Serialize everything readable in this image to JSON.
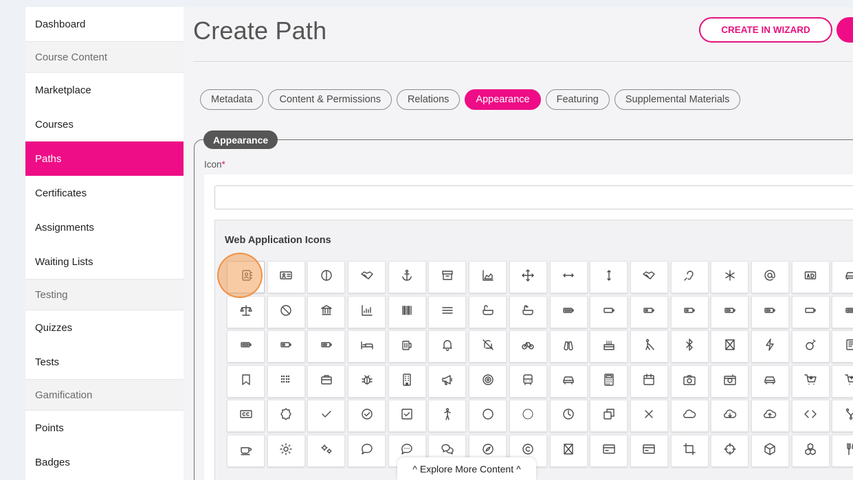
{
  "sidebar": {
    "items": [
      {
        "label": "Dashboard",
        "type": "item"
      },
      {
        "label": "Course Content",
        "type": "section"
      },
      {
        "label": "Marketplace",
        "type": "item"
      },
      {
        "label": "Courses",
        "type": "item"
      },
      {
        "label": "Paths",
        "type": "item",
        "active": true
      },
      {
        "label": "Certificates",
        "type": "item"
      },
      {
        "label": "Assignments",
        "type": "item"
      },
      {
        "label": "Waiting Lists",
        "type": "item"
      },
      {
        "label": "Testing",
        "type": "section"
      },
      {
        "label": "Quizzes",
        "type": "item"
      },
      {
        "label": "Tests",
        "type": "item"
      },
      {
        "label": "Gamification",
        "type": "section"
      },
      {
        "label": "Points",
        "type": "item"
      },
      {
        "label": "Badges",
        "type": "item"
      }
    ]
  },
  "header": {
    "title": "Create Path",
    "wizard_button": "CREATE IN WIZARD"
  },
  "tabs": [
    {
      "label": "Metadata",
      "active": false
    },
    {
      "label": "Content & Permissions",
      "active": false
    },
    {
      "label": "Relations",
      "active": false
    },
    {
      "label": "Appearance",
      "active": true
    },
    {
      "label": "Featuring",
      "active": false
    },
    {
      "label": "Supplemental Materials",
      "active": false
    }
  ],
  "appearance": {
    "legend": "Appearance",
    "icon_label": "Icon",
    "required_mark": "*",
    "search_value": "",
    "picker_heading": "Web Application Icons"
  },
  "icons": [
    [
      "address-book",
      "address-card",
      "adjust",
      "handshake",
      "anchor",
      "archive",
      "area-chart",
      "arrows",
      "arrows-h",
      "arrows-v",
      "handshake",
      "assistive-listening",
      "asterisk",
      "at",
      "ad",
      "car"
    ],
    [
      "balance-scale",
      "ban",
      "bank",
      "bar-chart",
      "barcode",
      "bars",
      "bath",
      "bathtub",
      "battery",
      "battery-empty",
      "battery-quarter",
      "battery-quarter",
      "battery-half",
      "battery-half",
      "battery-empty",
      "battery"
    ],
    [
      "battery",
      "battery-quarter",
      "battery-half",
      "bed",
      "beer",
      "bell",
      "bell-slash",
      "bicycle",
      "binoculars",
      "birthday-cake",
      "blind",
      "bluetooth",
      "hourglass",
      "bolt",
      "bomb",
      "book"
    ],
    [
      "bookmark",
      "braille",
      "briefcase",
      "bug",
      "building",
      "bullhorn",
      "bullseye",
      "bus",
      "car",
      "calculator",
      "calendar",
      "camera",
      "camera-retro",
      "car",
      "cart-arrow-down",
      "cart-plus"
    ],
    [
      "cc",
      "certificate",
      "check",
      "check-circle",
      "check-square",
      "child",
      "circle",
      "circle-thin",
      "clock",
      "clone",
      "close",
      "cloud",
      "cloud-download",
      "cloud-upload",
      "code",
      "code-fork"
    ],
    [
      "coffee",
      "cog",
      "cogs",
      "comment",
      "commenting",
      "comments",
      "compass",
      "copyright",
      "hourglass",
      "credit-card",
      "credit-card",
      "crop",
      "crosshairs",
      "cube",
      "cubes",
      "cutlery"
    ]
  ],
  "explore": {
    "label": "Explore More Content",
    "left_glyph": "^",
    "right_glyph": "^"
  },
  "colors": {
    "brand": "#ee0d86",
    "wizard_border": "#e6117f",
    "legend_bg": "#565656",
    "selected_highlight": "#f4a05a"
  }
}
